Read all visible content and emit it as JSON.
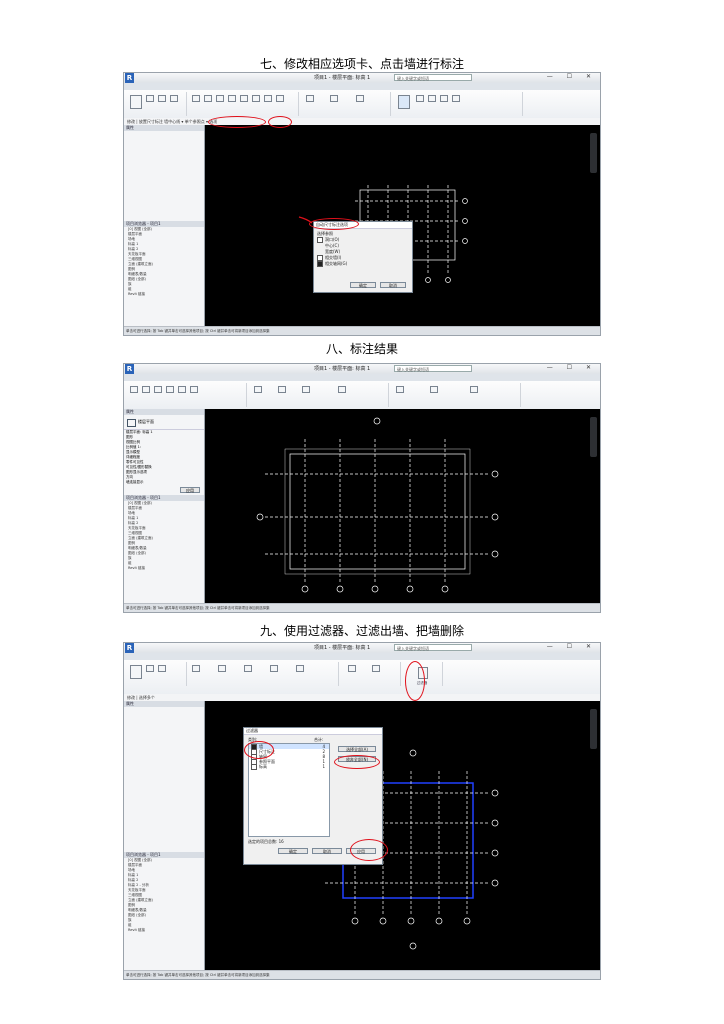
{
  "headings": {
    "step7": "七、修改相应选项卡、点击墙进行标注",
    "step8": "八、标注结果",
    "step9": "九、使用过滤器、过滤出墙、把墙删除"
  },
  "shot1": {
    "title": "项目1 - 楼层平面: 标高 1",
    "search_placeholder": "键入关键字或短语",
    "window_controls": "— ☐ ✕",
    "tabs": [
      "文件",
      "建筑",
      "结构",
      "系统",
      "插入",
      "注释",
      "分析",
      "体量和场地",
      "协作",
      "视图",
      "管理",
      "附加模块",
      "修改 | 放置尺寸标注"
    ],
    "active_tab": "修改 | 放置尺寸标注",
    "option_bar": "修改 | 放置尺寸标注   墙中心线  ▾   单个参照点 ▾   选项",
    "options_button": "选项",
    "left_panel_title": "属性",
    "browser_title": "项目浏览器 - 项目1",
    "browser_items": [
      "[0] 视图 (全部)",
      "楼层平面",
      "场地",
      "标高 1",
      "标高 2",
      "天花板平面",
      "三维视图",
      "立面 (建筑立面)",
      "图例",
      "明细表/数量",
      "图纸 (全部)",
      "族",
      "组",
      "Revit 链接"
    ],
    "dialog": {
      "title": "自动尺寸标注选项",
      "group_label": "选择参照",
      "option_openings": "洞口(O)",
      "option_centers": "中心(C)",
      "option_widths": "宽度(W)",
      "option_intersecting_walls": "相交墙(I)",
      "option_intersecting_grids": "相交轴网(G)",
      "ok": "确定",
      "cancel": "取消"
    },
    "status": "单击可进行选择; 按 Tab 键并单击可选择其他项目; 按 Ctrl 键并单击可将新项目添加到选择集",
    "scale": "1 : 100"
  },
  "shot2": {
    "title": "项目1 - 楼层平面: 标高 1",
    "search_placeholder": "键入关键字或短语",
    "window_controls": "— ☐ ✕",
    "tabs": [
      "文件",
      "建筑",
      "结构",
      "系统",
      "插入",
      "注释",
      "分析",
      "体量和场地",
      "协作",
      "视图",
      "管理",
      "附加模块",
      "修改"
    ],
    "active_tab": "修改",
    "left_panel_title": "属性",
    "type_name": "楼层平面",
    "props": [
      "楼层平面: 标高 1",
      "图形",
      "视图比例",
      "比例值 1:",
      "显示模型",
      "详细程度",
      "零件可见性",
      "可见性/图形替换",
      "图形显示选项",
      "方向",
      "墙连接显示"
    ],
    "apply_button": "应用",
    "browser_title": "项目浏览器 - 项目1",
    "browser_items": [
      "[0] 视图 (全部)",
      "楼层平面",
      "场地",
      "标高 1",
      "标高 2",
      "天花板平面",
      "三维视图",
      "立面 (建筑立面)",
      "图例",
      "明细表/数量",
      "图纸 (全部)",
      "族",
      "组",
      "Revit 链接"
    ],
    "status": "单击可进行选择; 按 Tab 键并单击可选择其他项目; 按 Ctrl 键并单击可将新项目添加到选择集",
    "scale": "1 : 100"
  },
  "shot3": {
    "title": "项目1 - 楼层平面: 标高 1",
    "search_placeholder": "键入关键字或短语",
    "window_controls": "— ☐ ✕",
    "tabs": [
      "文件",
      "建筑",
      "结构",
      "系统",
      "插入",
      "注释",
      "分析",
      "体量和场地",
      "协作",
      "视图",
      "管理",
      "附加模块",
      "修改 | 选择多个"
    ],
    "active_tab": "修改 | 选择多个",
    "option_bar": "修改 | 选择多个",
    "filter_ribbon_label": "过滤器",
    "left_panel_title": "属性",
    "browser_title": "项目浏览器 - 项目1",
    "browser_items": [
      "[0] 视图 (全部)",
      "楼层平面",
      "场地",
      "标高 1",
      "标高 2",
      "标高 2 - 分析",
      "天花板平面",
      "三维视图",
      "立面 (建筑立面)",
      "图例",
      "明细表/数量",
      "图纸 (全部)",
      "族",
      "组",
      "Revit 链接"
    ],
    "dialog": {
      "title": "过滤器",
      "col_category": "类别:",
      "col_count": "合计:",
      "rows": [
        {
          "label": "墙",
          "count": "4"
        },
        {
          "label": "尺寸标注",
          "count": "2"
        },
        {
          "label": "轴网",
          "count": "8"
        },
        {
          "label": "参照平面",
          "count": "1"
        },
        {
          "label": "标高",
          "count": "1"
        }
      ],
      "select_all": "选择全部(A)",
      "check_none": "放弃全部(N)",
      "total_label": "选定的项目总数:",
      "total_value": "16",
      "ok": "确定",
      "cancel": "取消",
      "apply": "应用"
    },
    "status": "单击可进行选择; 按 Tab 键并单击可选择其他项目; 按 Ctrl 键并单击可将新项目添加到选择集",
    "scale": "1 : 100"
  },
  "colors": {
    "annotation_red": "#e0101a",
    "canvas": "#000000",
    "wall_highlight": "#2040ff"
  }
}
